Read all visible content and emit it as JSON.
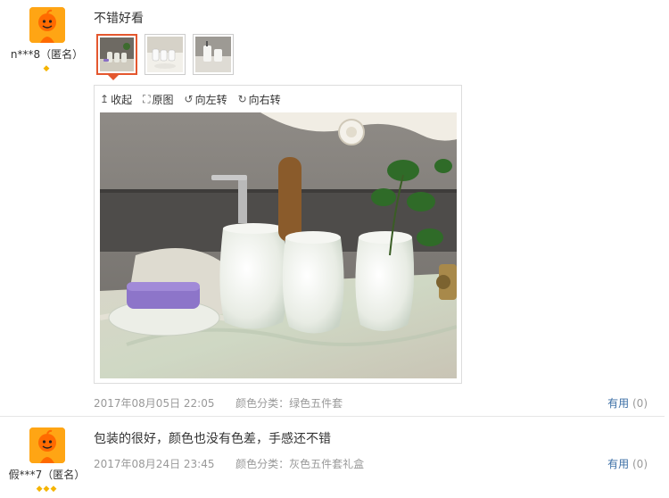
{
  "reviews": [
    {
      "user": "n***8（匿名）",
      "level": "◆",
      "text": "不错好看",
      "date": "2017年08月05日 22:05",
      "sku_label": "颜色分类：",
      "sku_value": "绿色五件套",
      "useful_label": "有用",
      "useful_count": "(0)",
      "viewer_tools": [
        {
          "icon": "↥",
          "label": "收起"
        },
        {
          "icon": "⛶",
          "label": "原图"
        },
        {
          "icon": "↺",
          "label": "向左转"
        },
        {
          "icon": "↻",
          "label": "向右转"
        }
      ]
    },
    {
      "user": "假***7（匿名）",
      "level": "◆◆◆",
      "text": "包装的很好，颜色也没有色差，手感还不错",
      "date": "2017年08月24日 23:45",
      "sku_label": "颜色分类：",
      "sku_value": "灰色五件套礼盒",
      "useful_label": "有用",
      "useful_count": "(0)"
    }
  ],
  "colors": {
    "accent": "#e4572e",
    "link": "#3c6fa6",
    "diamond": "#f5b400",
    "avatar": "#ffa514"
  }
}
